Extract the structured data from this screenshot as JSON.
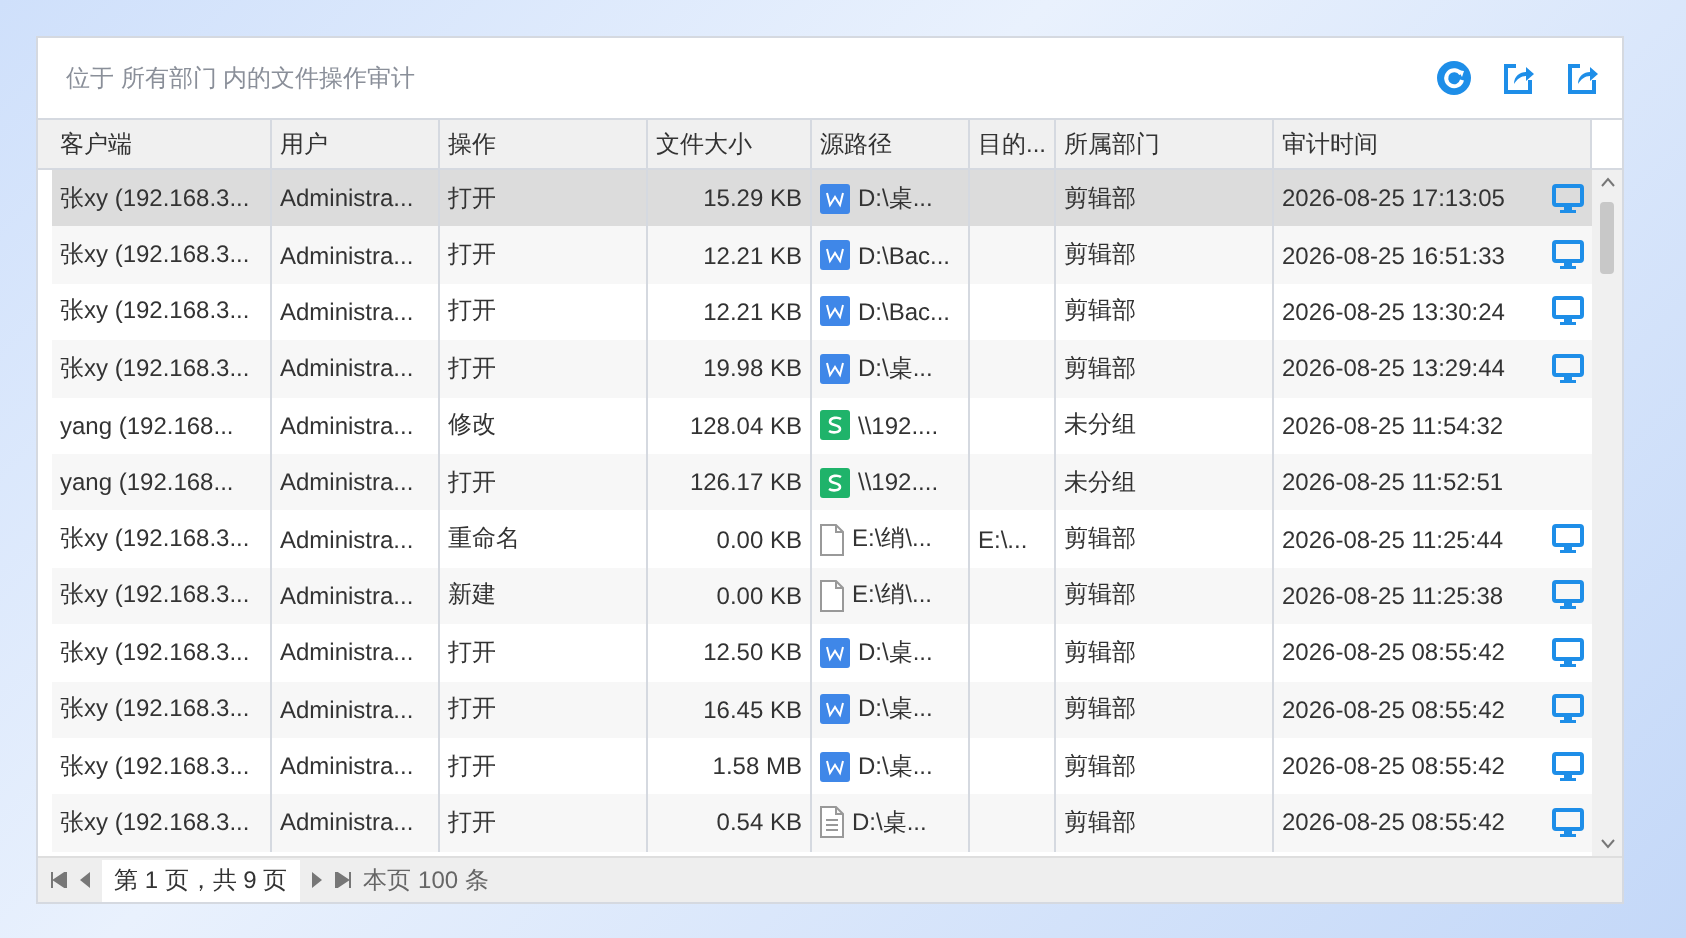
{
  "header": {
    "title": "位于 所有部门 内的文件操作审计"
  },
  "table": {
    "columns": [
      "客户端",
      "用户",
      "操作",
      "文件大小",
      "源路径",
      "目的...",
      "所属部门",
      "审计时间"
    ],
    "rows": [
      {
        "selected": true,
        "client": "张xy (192.168.3...",
        "user": "Administra...",
        "action": "打开",
        "size": "15.29 KB",
        "file": {
          "kind": "word"
        },
        "source": "D:\\桌...",
        "dept": "剪辑部",
        "time": "2026-08-25 17:13:05",
        "online": true
      },
      {
        "selected": false,
        "client": "张xy (192.168.3...",
        "user": "Administra...",
        "action": "打开",
        "size": "12.21 KB",
        "file": {
          "kind": "word"
        },
        "source": "D:\\Bac...",
        "dept": "剪辑部",
        "time": "2026-08-25 16:51:33",
        "online": true
      },
      {
        "selected": false,
        "client": "张xy (192.168.3...",
        "user": "Administra...",
        "action": "打开",
        "size": "12.21 KB",
        "file": {
          "kind": "word"
        },
        "source": "D:\\Bac...",
        "dept": "剪辑部",
        "time": "2026-08-25 13:30:24",
        "online": true
      },
      {
        "selected": false,
        "client": "张xy (192.168.3...",
        "user": "Administra...",
        "action": "打开",
        "size": "19.98 KB",
        "file": {
          "kind": "word"
        },
        "source": "D:\\桌...",
        "dept": "剪辑部",
        "time": "2026-08-25 13:29:44",
        "online": true
      },
      {
        "selected": false,
        "client": "yang (192.168...",
        "user": "Administra...",
        "action": "修改",
        "size": "128.04 KB",
        "file": {
          "kind": "sheet"
        },
        "source": "\\\\192....",
        "dept": "未分组",
        "time": "2026-08-25 11:54:32",
        "online": false
      },
      {
        "selected": false,
        "client": "yang (192.168...",
        "user": "Administra...",
        "action": "打开",
        "size": "126.17 KB",
        "file": {
          "kind": "sheet"
        },
        "source": "\\\\192....",
        "dept": "未分组",
        "time": "2026-08-25 11:52:51",
        "online": false
      },
      {
        "selected": false,
        "client": "张xy (192.168.3...",
        "user": "Administra...",
        "action": "重命名",
        "size": "0.00 KB",
        "file": {
          "kind": "blank"
        },
        "source": "E:\\绡\\...",
        "dest": "E:\\...",
        "dept": "剪辑部",
        "time": "2026-08-25 11:25:44",
        "online": true
      },
      {
        "selected": false,
        "client": "张xy (192.168.3...",
        "user": "Administra...",
        "action": "新建",
        "size": "0.00 KB",
        "file": {
          "kind": "blank"
        },
        "source": "E:\\绡\\...",
        "dept": "剪辑部",
        "time": "2026-08-25 11:25:38",
        "online": true
      },
      {
        "selected": false,
        "client": "张xy (192.168.3...",
        "user": "Administra...",
        "action": "打开",
        "size": "12.50 KB",
        "file": {
          "kind": "word"
        },
        "source": "D:\\桌...",
        "dept": "剪辑部",
        "time": "2026-08-25 08:55:42",
        "online": true
      },
      {
        "selected": false,
        "client": "张xy (192.168.3...",
        "user": "Administra...",
        "action": "打开",
        "size": "16.45 KB",
        "file": {
          "kind": "word"
        },
        "source": "D:\\桌...",
        "dept": "剪辑部",
        "time": "2026-08-25 08:55:42",
        "online": true
      },
      {
        "selected": false,
        "client": "张xy (192.168.3...",
        "user": "Administra...",
        "action": "打开",
        "size": "1.58 MB",
        "file": {
          "kind": "word"
        },
        "source": "D:\\桌...",
        "dept": "剪辑部",
        "time": "2026-08-25 08:55:42",
        "online": true
      },
      {
        "selected": false,
        "client": "张xy (192.168.3...",
        "user": "Administra...",
        "action": "打开",
        "size": "0.54 KB",
        "file": {
          "kind": "text"
        },
        "source": "D:\\桌...",
        "dept": "剪辑部",
        "time": "2026-08-25 08:55:42",
        "online": true
      }
    ]
  },
  "pager": {
    "page_info": "第 1 页，共 9 页",
    "count": "本页 100 条"
  }
}
